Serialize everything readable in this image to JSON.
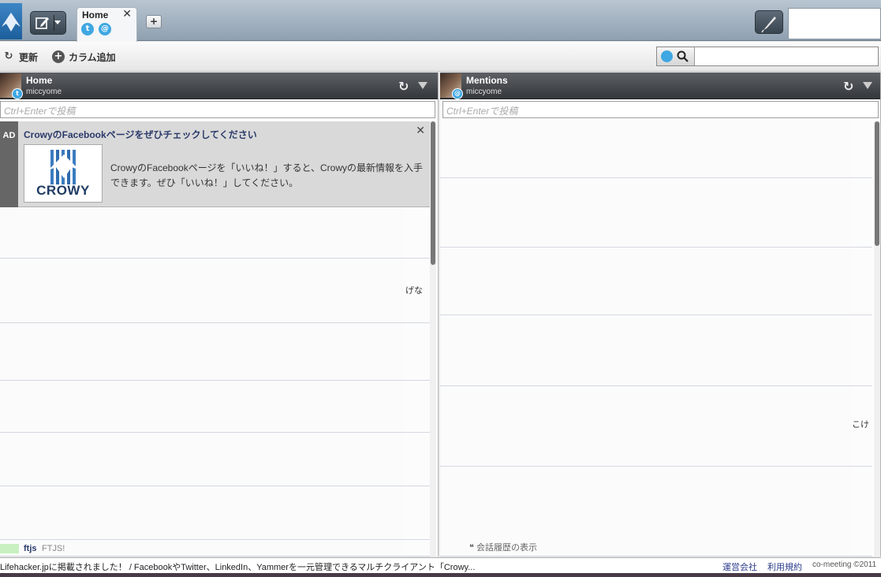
{
  "app": {
    "brand_color": "#2a6fb0",
    "accent_twitter": "#3fa7e2"
  },
  "tabs": [
    {
      "label": "Home",
      "close": "✕",
      "icons": [
        "twitter-icon",
        "mention-icon"
      ]
    }
  ],
  "add_tab_label": "+",
  "toolbar": {
    "refresh_label": "更新",
    "add_column_label": "カラム追加"
  },
  "search": {
    "placeholder": "",
    "value": ""
  },
  "columns": [
    {
      "title": "Home",
      "user": "miccyome",
      "post_placeholder": "Ctrl+Enterで投稿",
      "ad": {
        "tag": "AD",
        "title": "CrowyのFacebookページをぜひチェックしてください",
        "close": "✕",
        "thumb_word": "CROWY",
        "body": "CrowyのFacebookページを「いいね！」すると、Crowyの最新情報を入手できます。ぜひ「いいね！」してください。"
      },
      "fragments": [
        "げな"
      ],
      "last_tweet": {
        "user": "ftjs",
        "text": "FTJS!"
      }
    },
    {
      "title": "Mentions",
      "user": "miccyome",
      "post_placeholder": "Ctrl+Enterで投稿",
      "fragments": [
        "こけ"
      ],
      "conversation_link": "会話履歴の表示"
    }
  ],
  "footer": {
    "news": "Lifehacker.jpに掲載されました！ / FacebookやTwitter、LinkedIn、Yammerを一元管理できるマルチクライアント「Crowy...",
    "company_link": "運営会社",
    "terms_link": "利用規約",
    "copyright": "co-meeting ©2011"
  }
}
